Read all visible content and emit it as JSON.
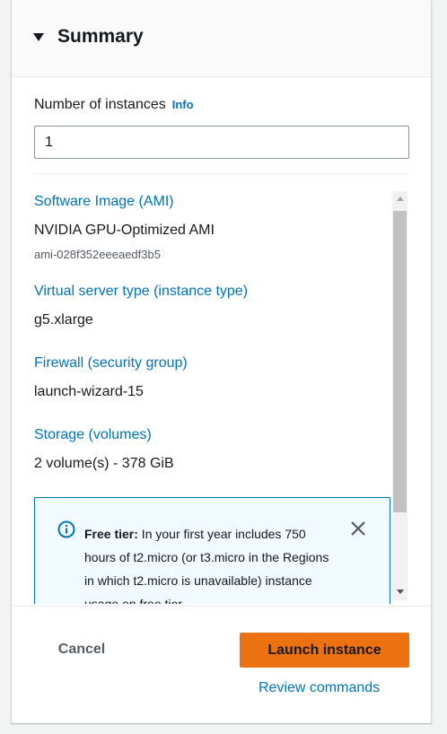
{
  "summary": {
    "title": "Summary",
    "caret_icon": "caret-down-icon"
  },
  "instances": {
    "label": "Number of instances",
    "info_label": "Info",
    "value": "1"
  },
  "details": {
    "ami_title": "Software Image (AMI)",
    "ami_name": "NVIDIA GPU-Optimized AMI",
    "ami_id": "ami-028f352eeeaedf3b5",
    "instance_type_title": "Virtual server type (instance type)",
    "instance_type_value": "g5.xlarge",
    "firewall_title": "Firewall (security group)",
    "firewall_value": "launch-wizard-15",
    "storage_title": "Storage (volumes)",
    "storage_value": "2 volume(s) - 378 GiB"
  },
  "free_tier": {
    "icon": "info-icon",
    "bold": "Free tier:",
    "text": " In your first year includes 750 hours of t2.micro (or t3.micro in the Regions in which t2.micro is unavailable) instance usage on free tier",
    "close_icon": "close-icon"
  },
  "footer": {
    "cancel_label": "Cancel",
    "launch_label": "Launch instance",
    "review_label": "Review commands"
  },
  "colors": {
    "link": "#0073bb",
    "primary_button": "#ec7211",
    "text": "#16191f"
  }
}
